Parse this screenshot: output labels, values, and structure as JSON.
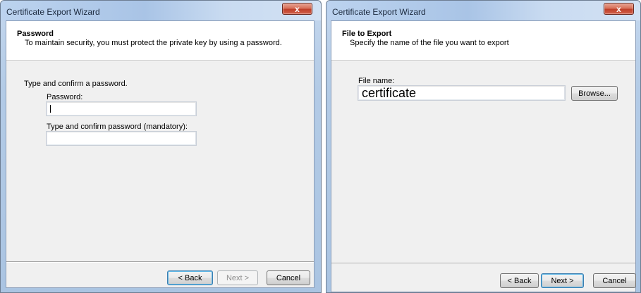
{
  "left_dialog": {
    "title": "Certificate Export Wizard",
    "close_glyph": "x",
    "header_title": "Password",
    "header_desc": "To maintain security, you must protect the private key by using a password.",
    "prompt": "Type and confirm a password.",
    "password_label": "Password:",
    "password_value": "",
    "confirm_label": "Type and confirm password (mandatory):",
    "confirm_value": "",
    "buttons": {
      "back": "< Back",
      "next": "Next >",
      "cancel": "Cancel"
    }
  },
  "right_dialog": {
    "title": "Certificate Export Wizard",
    "close_glyph": "x",
    "header_title": "File to Export",
    "header_desc": "Specify the name of the file you want to export",
    "file_label": "File name:",
    "file_value": "certificate",
    "browse": "Browse...",
    "buttons": {
      "back": "< Back",
      "next": "Next >",
      "cancel": "Cancel"
    }
  },
  "icons": {
    "close": "close-icon"
  },
  "colors": {
    "client_bg": "#f0f0f0",
    "focus_border": "#3c7fb1",
    "close_red": "#c0402a"
  }
}
